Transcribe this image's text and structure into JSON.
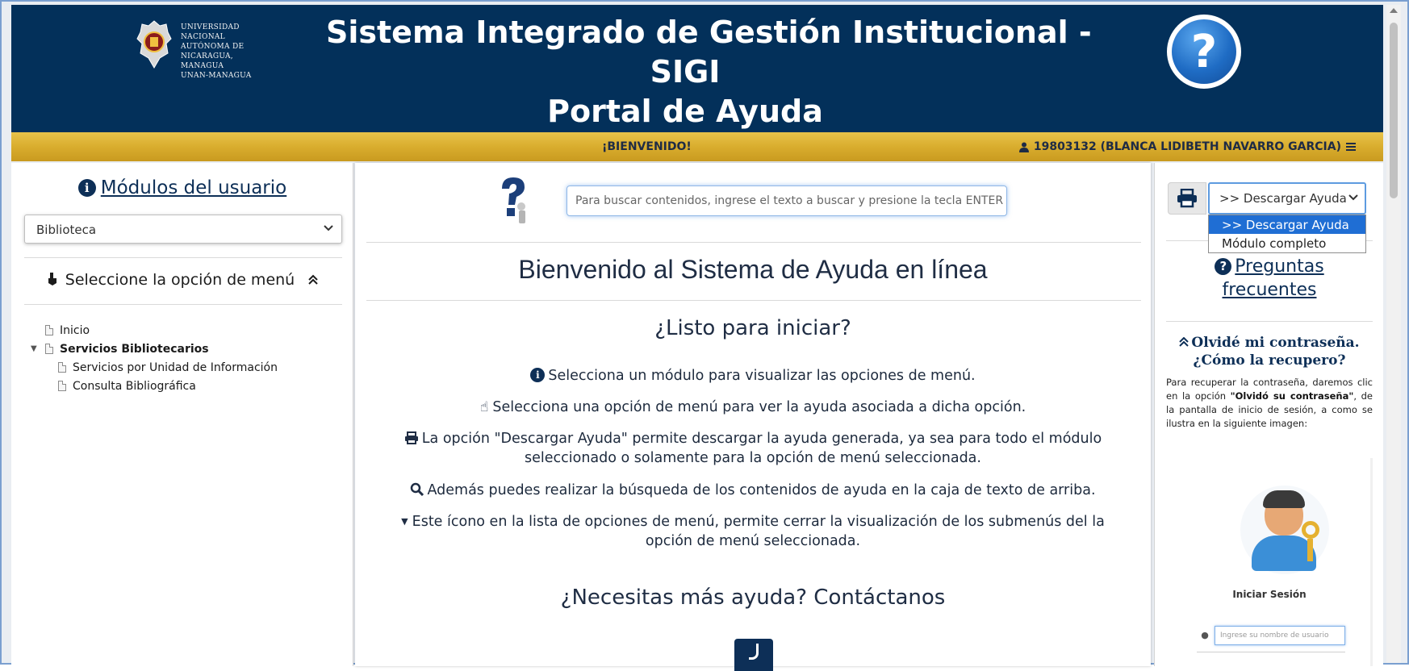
{
  "header": {
    "logo_text": "UNIVERSIDAD\nNACIONAL\nAUTÓNOMA DE\nNICARAGUA,\nMANAGUA\nUNAN-MANAGUA",
    "title_line1": "Sistema Integrado de Gestión Institucional -",
    "title_line2": "SIGI",
    "title_line3": "Portal de Ayuda",
    "help_symbol": "?"
  },
  "gold_bar": {
    "welcome": "¡BIENVENIDO!",
    "user": "19803132 (BLANCA LIDIBETH NAVARRO GARCIA)"
  },
  "left": {
    "modules_title": "Módulos del usuario",
    "module_selected": "Biblioteca",
    "menu_heading": "Seleccione la opción de menú",
    "tree": [
      {
        "label": "Inicio"
      },
      {
        "label": "Servicios Bibliotecarios"
      },
      {
        "label": "Servicios por Unidad de Información"
      },
      {
        "label": "Consulta Bibliográfica"
      }
    ]
  },
  "center": {
    "search_placeholder": "Para buscar contenidos, ingrese el texto a buscar y presione la tecla ENTER",
    "welcome_heading": "Bienvenido al Sistema de Ayuda en línea",
    "ready_heading": "¿Listo para iniciar?",
    "instructions": [
      "Selecciona un módulo para visualizar las opciones de menú.",
      "Selecciona una opción de menú para ver la ayuda asociada a dicha opción.",
      "La opción \"Descargar Ayuda\" permite descargar la ayuda generada, ya sea para todo el módulo seleccionado o solamente para la opción de menú seleccionada.",
      "Además puedes realizar la búsqueda de los contenidos de ayuda en la caja de texto de arriba.",
      "Este ícono en la lista de opciones de menú, permite cerrar la visualización de los submenús del la opción de menú seleccionada."
    ],
    "help_heading": "¿Necesitas más ayuda? Contáctanos"
  },
  "right": {
    "download_selected": ">> Descargar Ayuda",
    "download_options": [
      ">> Descargar Ayuda",
      "Módulo completo"
    ],
    "faq_title": "Preguntas frecuentes",
    "forgot_title": "Olvidé mi contraseña. ¿Cómo la recupero?",
    "forgot_body_pre": "Para recuperar la contraseña, daremos clic en la opción ",
    "forgot_body_bold": "\"Olvidó su contraseña\"",
    "forgot_body_post": ", de la pantalla de inicio de sesión, a como se ilustra en la siguiente imagen:",
    "login_label": "Iniciar Sesión",
    "login_placeholder": "Ingrese su nombre de usuario"
  },
  "colors": {
    "header_bg": "#03305a",
    "gold_bar": "#d9ad2e",
    "accent_blue": "#1f6ed4",
    "text_dark": "#1f2d44"
  }
}
